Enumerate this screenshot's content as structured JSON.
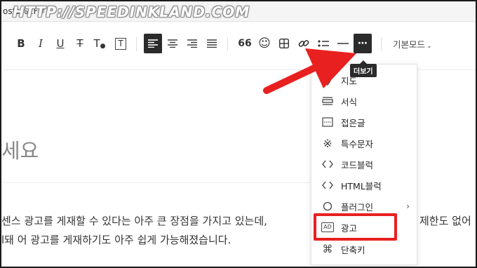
{
  "browser": {
    "url_fragment": "osts%2F#"
  },
  "watermark": "HTTP://SPEEDINKLAND.COM",
  "toolbar": {
    "bold": "B",
    "italic": "I",
    "underline": "U",
    "strikethrough": "T",
    "text_color": "T",
    "bg_color": "T",
    "quote": "66",
    "more_label": "⋯",
    "mode_label": "기본모드"
  },
  "tooltip": "더보기",
  "editor": {
    "title": "세요",
    "para_line1": "센스 광고를 게재할 수 있다는 아주 큰 장점을 가지고 있는데,",
    "para_line1_right": "제한도 없어",
    "para_line2": "l돼 어 광고를 게재하기도 아주 쉽게 가능해졌습니다."
  },
  "more_menu": {
    "items": [
      {
        "label": "지도",
        "icon": "map-pin-icon"
      },
      {
        "label": "서식",
        "icon": "format-lines-icon"
      },
      {
        "label": "접은글",
        "icon": "folded-text-icon"
      },
      {
        "label": "특수문자",
        "icon": "special-char-icon"
      },
      {
        "label": "코드블럭",
        "icon": "code-block-icon"
      },
      {
        "label": "HTML블럭",
        "icon": "html-block-icon"
      },
      {
        "label": "플러그인",
        "icon": "plugin-icon"
      },
      {
        "label": "광고",
        "icon": "ad-icon"
      },
      {
        "label": "단축키",
        "icon": "shortcut-key-icon"
      }
    ],
    "ad_icon_text": "AD"
  },
  "colors": {
    "highlight": "#e8201f",
    "arrow": "#e8201f",
    "active_button": "#2b2b2b"
  }
}
